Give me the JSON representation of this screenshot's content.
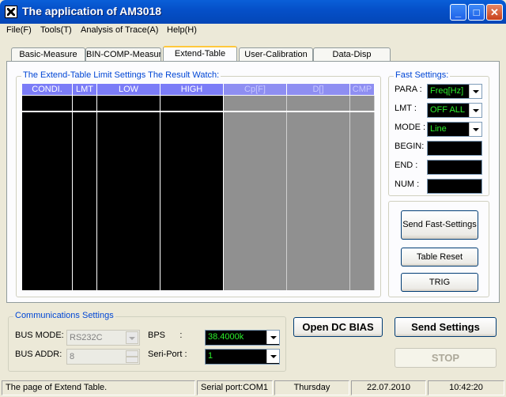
{
  "window": {
    "title": "The application of AM3018",
    "min_glyph": "_",
    "max_glyph": "□",
    "close_glyph": "✕"
  },
  "menu": [
    "File(F)",
    "Tools(T)",
    "Analysis of Trace(A)",
    "Help(H)"
  ],
  "tabs": [
    "Basic-Measure",
    "BIN-COMP-Measure",
    "Extend-Table",
    "User-Calibration",
    "Data-Disp"
  ],
  "active_tab": "Extend-Table",
  "limit_group": {
    "label": "The Extend-Table Limit Settings  The Result Watch:",
    "columns": [
      "CONDI.",
      "LMT",
      "LOW",
      "HIGH",
      "Cp[F]",
      "D[]",
      "CMP"
    ]
  },
  "fast_settings": {
    "label": "Fast Settings:",
    "para_label": "PARA :",
    "para_value": "Freq[Hz]",
    "lmt_label": "LMT :",
    "lmt_value": "OFF ALL",
    "mode_label": "MODE :",
    "mode_value": "Line",
    "begin_label": "BEGIN:",
    "end_label": "END :",
    "num_label": "NUM :"
  },
  "actions": {
    "send_fast": "Send Fast-Settings",
    "table_reset": "Table Reset",
    "trig": "TRIG"
  },
  "comm": {
    "label": "Communications Settings",
    "bus_mode_label": "BUS MODE:",
    "bus_mode_value": "RS232C",
    "bus_addr_label": "BUS ADDR:",
    "bus_addr_value": "8",
    "bps_label": "BPS      :",
    "bps_value": "38.4000k",
    "port_label": "Seri-Port :",
    "port_value": "1"
  },
  "buttons": {
    "open_dc_bias": "Open DC BIAS",
    "send_settings": "Send Settings",
    "stop": "STOP"
  },
  "status": {
    "message": "The page of Extend Table.",
    "serial": "Serial port:COM1",
    "day": "Thursday",
    "date": "22.07.2010",
    "time": "10:42:20"
  },
  "colors": {
    "header": "#7b7cf7",
    "value_green": "#2cf02c",
    "group_label": "#0046d5"
  }
}
